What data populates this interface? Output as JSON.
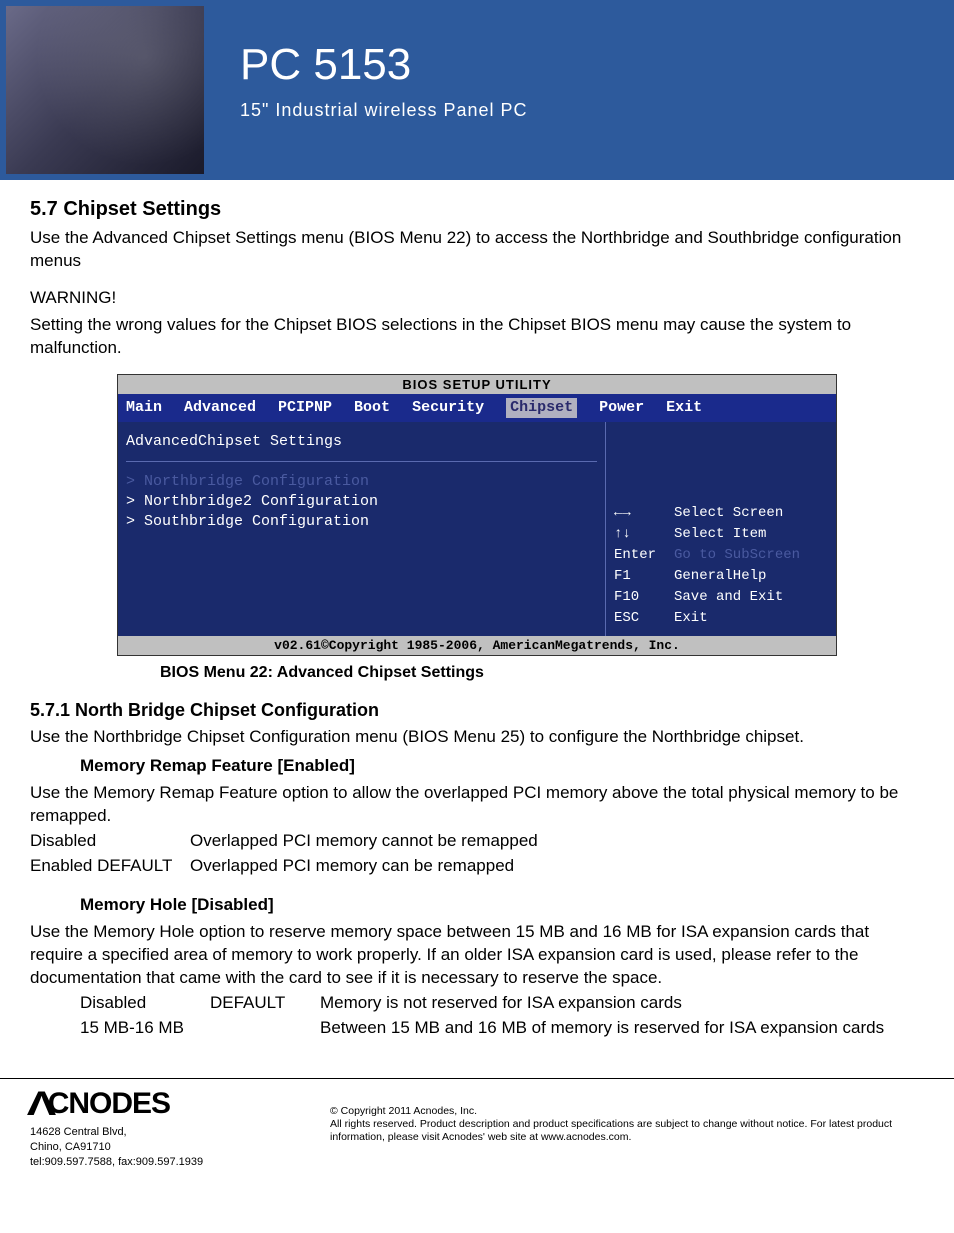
{
  "header": {
    "title": "PC 5153",
    "subtitle": "15\" Industrial wireless Panel PC"
  },
  "section": {
    "head": "5.7 Chipset Settings",
    "intro": "Use the Advanced Chipset Settings menu (BIOS Menu 22) to access the Northbridge and Southbridge configuration menus",
    "warn_label": "WARNING!",
    "warn_text": "Setting the wrong values for the Chipset BIOS selections in the Chipset BIOS menu may cause the system to malfunction."
  },
  "bios": {
    "bar": "BIOS SETUP UTILITY",
    "tabs": [
      "Main",
      "Advanced",
      "PCIPNP",
      "Boot",
      "Security",
      "Chipset",
      "Power",
      "Exit"
    ],
    "selected_tab_index": 5,
    "panel_title": "AdvancedChipset Settings",
    "lines": [
      {
        "text": "> Northbridge Configuration",
        "dim": true
      },
      {
        "text": "> Northbridge2 Configuration",
        "dim": false
      },
      {
        "text": "> Southbridge Configuration",
        "dim": false
      }
    ],
    "help": [
      {
        "key": "←→",
        "label": "Select Screen",
        "faded": false
      },
      {
        "key": "↑↓",
        "label": "Select Item",
        "faded": false
      },
      {
        "key": "Enter",
        "label": "Go to SubScreen",
        "faded": true
      },
      {
        "key": "F1",
        "label": "GeneralHelp",
        "faded": false
      },
      {
        "key": "F10",
        "label": "Save and Exit",
        "faded": false
      },
      {
        "key": "ESC",
        "label": "Exit",
        "faded": false
      }
    ],
    "footer": "v02.61©Copyright 1985-2006, AmericanMegatrends, Inc.",
    "caption": "BIOS Menu 22: Advanced Chipset Settings"
  },
  "sub571": {
    "head": "5.7.1 North Bridge Chipset Configuration",
    "text": "Use the Northbridge Chipset Configuration menu (BIOS Menu 25) to configure the Northbridge chipset."
  },
  "mem_remap": {
    "head": "Memory Remap Feature [Enabled]",
    "text": "Use the Memory Remap Feature option to allow the overlapped PCI memory above the total physical memory to be remapped.",
    "opts": [
      {
        "a": "Disabled",
        "b": "Overlapped PCI memory cannot be remapped"
      },
      {
        "a": "Enabled DEFAULT",
        "b": "Overlapped PCI memory can be remapped"
      }
    ]
  },
  "mem_hole": {
    "head": "Memory Hole [Disabled]",
    "text": "Use the Memory Hole option to reserve memory space between 15 MB and 16 MB for ISA expansion cards that require a specified area of memory to work properly. If an older ISA expansion card is used, please refer to the documentation that came with the card to see if it is necessary to reserve the space.",
    "opts": [
      {
        "a": "Disabled",
        "b": "DEFAULT",
        "c": "Memory is not reserved for ISA expansion cards"
      },
      {
        "a": "15 MB-16 MB",
        "b": "",
        "c": "Between 15 MB and 16 MB of memory is reserved for ISA expansion cards"
      }
    ]
  },
  "footer": {
    "brand": "CNODES",
    "addr1": "14628 Central Blvd,",
    "addr2": "Chino, CA91710",
    "addr3": "tel:909.597.7588, fax:909.597.1939",
    "copyright": "© Copyright 2011 Acnodes, Inc.",
    "legal": "All rights reserved. Product description and product specifications are subject to change without notice. For latest product information, please visit Acnodes' web site at www.acnodes.com."
  }
}
